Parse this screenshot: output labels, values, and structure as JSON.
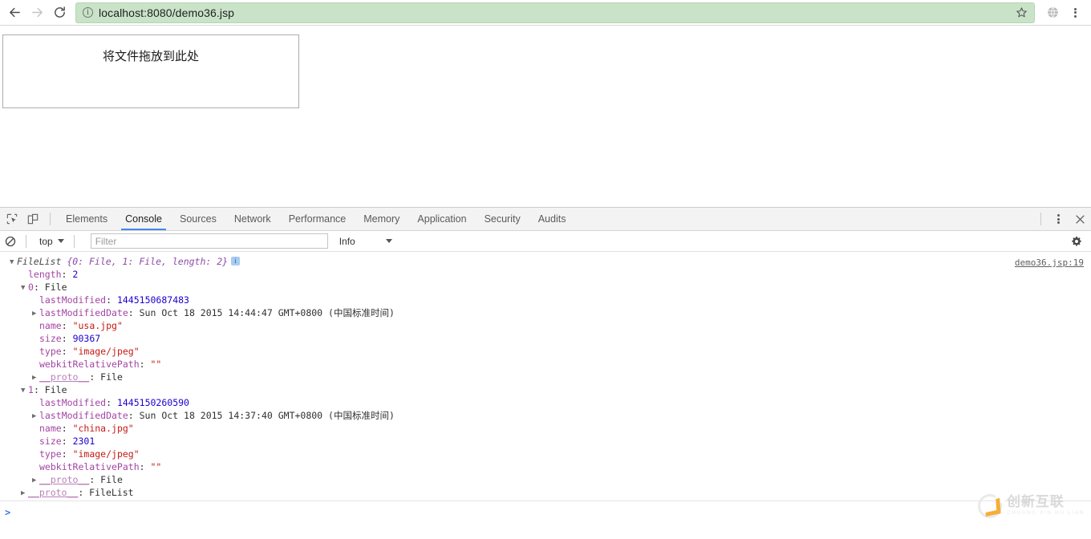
{
  "browser": {
    "back_icon": "arrow-left-icon",
    "forward_icon": "arrow-right-icon",
    "reload_icon": "reload-icon",
    "security_icon": "info-circle-icon",
    "url": "localhost:8080/demo36.jsp",
    "bookmark_icon": "star-icon",
    "profile_icon": "globe-icon",
    "menu_icon": "kebab-menu-icon",
    "omnibox_bg": "#c9e3c8"
  },
  "page": {
    "dropzone_label": "将文件拖放到此处"
  },
  "devtools": {
    "inspect_icon": "inspect-element-icon",
    "device_icon": "device-toolbar-icon",
    "tabs": [
      {
        "label": "Elements",
        "active": false
      },
      {
        "label": "Console",
        "active": true
      },
      {
        "label": "Sources",
        "active": false
      },
      {
        "label": "Network",
        "active": false
      },
      {
        "label": "Performance",
        "active": false
      },
      {
        "label": "Memory",
        "active": false
      },
      {
        "label": "Application",
        "active": false
      },
      {
        "label": "Security",
        "active": false
      },
      {
        "label": "Audits",
        "active": false
      }
    ],
    "more_icon": "kebab-menu-icon",
    "close_icon": "close-icon",
    "active_tab_accent": "#4285f4",
    "console_toolbar": {
      "clear_icon": "clear-console-icon",
      "context": "top",
      "filter_value": "",
      "filter_placeholder": "Filter",
      "level": "Info",
      "settings_icon": "gear-icon"
    },
    "console": {
      "source_link": "demo36.jsp:19",
      "prompt": ">",
      "lines": [
        {
          "indent": 0,
          "arrow": "open",
          "parts": [
            {
              "cls": "tok-class",
              "t": "FileList "
            },
            {
              "cls": "tok-preview",
              "t": "{0: File, 1: File, length: 2}"
            }
          ],
          "badge": true
        },
        {
          "indent": 1,
          "arrow": "none",
          "parts": [
            {
              "cls": "tok-prop",
              "t": "length"
            },
            {
              "cls": "tok-plain",
              "t": ": "
            },
            {
              "cls": "tok-num",
              "t": "2"
            }
          ]
        },
        {
          "indent": 0,
          "arrow": "open",
          "offset": 1,
          "parts": [
            {
              "cls": "tok-prop",
              "t": "0"
            },
            {
              "cls": "tok-plain",
              "t": ": "
            },
            {
              "cls": "tok-obj",
              "t": "File"
            }
          ]
        },
        {
          "indent": 2,
          "arrow": "none",
          "parts": [
            {
              "cls": "tok-prop",
              "t": "lastModified"
            },
            {
              "cls": "tok-plain",
              "t": ": "
            },
            {
              "cls": "tok-num",
              "t": "1445150687483"
            }
          ]
        },
        {
          "indent": 1,
          "arrow": "closed",
          "offset": 1,
          "parts": [
            {
              "cls": "tok-prop",
              "t": "lastModifiedDate"
            },
            {
              "cls": "tok-plain",
              "t": ": Sun Oct 18 2015 14:44:47 GMT+0800 (中国标准时间)"
            }
          ]
        },
        {
          "indent": 2,
          "arrow": "none",
          "parts": [
            {
              "cls": "tok-prop",
              "t": "name"
            },
            {
              "cls": "tok-plain",
              "t": ": "
            },
            {
              "cls": "tok-str",
              "t": "\"usa.jpg\""
            }
          ]
        },
        {
          "indent": 2,
          "arrow": "none",
          "parts": [
            {
              "cls": "tok-prop",
              "t": "size"
            },
            {
              "cls": "tok-plain",
              "t": ": "
            },
            {
              "cls": "tok-num",
              "t": "90367"
            }
          ]
        },
        {
          "indent": 2,
          "arrow": "none",
          "parts": [
            {
              "cls": "tok-prop",
              "t": "type"
            },
            {
              "cls": "tok-plain",
              "t": ": "
            },
            {
              "cls": "tok-str",
              "t": "\"image/jpeg\""
            }
          ]
        },
        {
          "indent": 2,
          "arrow": "none",
          "parts": [
            {
              "cls": "tok-prop",
              "t": "webkitRelativePath"
            },
            {
              "cls": "tok-plain",
              "t": ": "
            },
            {
              "cls": "tok-str",
              "t": "\"\""
            }
          ]
        },
        {
          "indent": 2,
          "arrow": "closed",
          "parts": [
            {
              "cls": "tok-proto",
              "t": "__proto__"
            },
            {
              "cls": "tok-plain",
              "t": ": "
            },
            {
              "cls": "tok-obj",
              "t": "File"
            }
          ]
        },
        {
          "indent": 0,
          "arrow": "open",
          "offset": 1,
          "parts": [
            {
              "cls": "tok-prop",
              "t": "1"
            },
            {
              "cls": "tok-plain",
              "t": ": "
            },
            {
              "cls": "tok-obj",
              "t": "File"
            }
          ]
        },
        {
          "indent": 2,
          "arrow": "none",
          "parts": [
            {
              "cls": "tok-prop",
              "t": "lastModified"
            },
            {
              "cls": "tok-plain",
              "t": ": "
            },
            {
              "cls": "tok-num",
              "t": "1445150260590"
            }
          ]
        },
        {
          "indent": 1,
          "arrow": "closed",
          "offset": 1,
          "parts": [
            {
              "cls": "tok-prop",
              "t": "lastModifiedDate"
            },
            {
              "cls": "tok-plain",
              "t": ": Sun Oct 18 2015 14:37:40 GMT+0800 (中国标准时间)"
            }
          ]
        },
        {
          "indent": 2,
          "arrow": "none",
          "parts": [
            {
              "cls": "tok-prop",
              "t": "name"
            },
            {
              "cls": "tok-plain",
              "t": ": "
            },
            {
              "cls": "tok-str",
              "t": "\"china.jpg\""
            }
          ]
        },
        {
          "indent": 2,
          "arrow": "none",
          "parts": [
            {
              "cls": "tok-prop",
              "t": "size"
            },
            {
              "cls": "tok-plain",
              "t": ": "
            },
            {
              "cls": "tok-num",
              "t": "2301"
            }
          ]
        },
        {
          "indent": 2,
          "arrow": "none",
          "parts": [
            {
              "cls": "tok-prop",
              "t": "type"
            },
            {
              "cls": "tok-plain",
              "t": ": "
            },
            {
              "cls": "tok-str",
              "t": "\"image/jpeg\""
            }
          ]
        },
        {
          "indent": 2,
          "arrow": "none",
          "parts": [
            {
              "cls": "tok-prop",
              "t": "webkitRelativePath"
            },
            {
              "cls": "tok-plain",
              "t": ": "
            },
            {
              "cls": "tok-str",
              "t": "\"\""
            }
          ]
        },
        {
          "indent": 2,
          "arrow": "closed",
          "parts": [
            {
              "cls": "tok-proto",
              "t": "__proto__"
            },
            {
              "cls": "tok-plain",
              "t": ": "
            },
            {
              "cls": "tok-obj",
              "t": "File"
            }
          ]
        },
        {
          "indent": 1,
          "arrow": "closed",
          "parts": [
            {
              "cls": "tok-proto",
              "t": "__proto__"
            },
            {
              "cls": "tok-plain",
              "t": ": "
            },
            {
              "cls": "tok-obj",
              "t": "FileList"
            }
          ]
        }
      ]
    }
  },
  "watermark": {
    "title": "创新互联",
    "pinyin": "CHUANG XIN HU LIAN",
    "accent": "#f5a623"
  }
}
